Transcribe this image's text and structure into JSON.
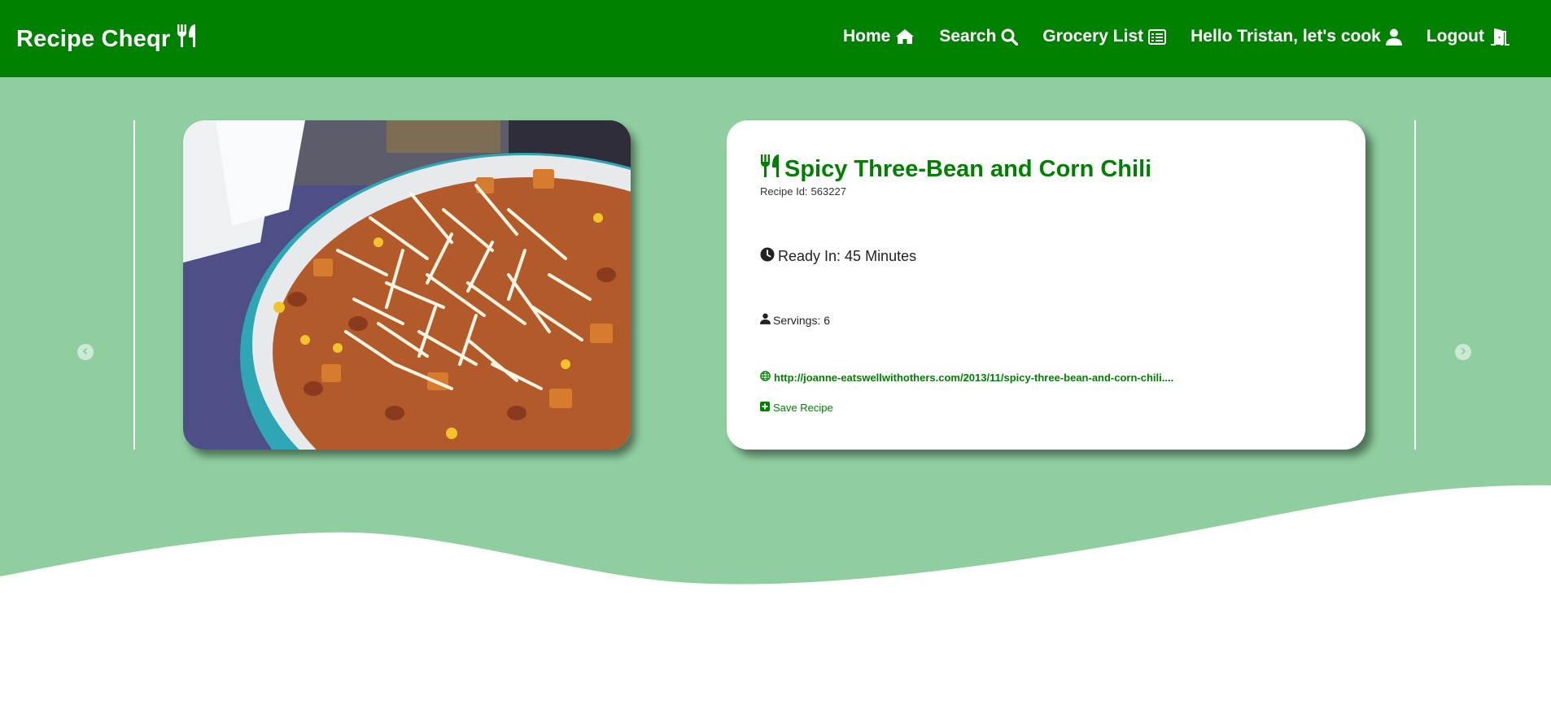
{
  "app": {
    "brand": "Recipe Cheqr",
    "brand_icon": "fork-knife-icon"
  },
  "nav": {
    "items": [
      {
        "label": "Home",
        "icon": "home-icon"
      },
      {
        "label": "Search",
        "icon": "search-icon"
      },
      {
        "label": "Grocery List",
        "icon": "list-icon"
      },
      {
        "label": "Hello Tristan, let's cook",
        "icon": "user-icon"
      },
      {
        "label": "Logout",
        "icon": "door-icon"
      }
    ]
  },
  "recipe": {
    "title": "Spicy Three-Bean and Corn Chili",
    "id_label": "Recipe Id:",
    "id_value": "563227",
    "ready_in": "Ready In: 45 Minutes",
    "servings": "Servings: 6",
    "source_url": "http://joanne-eatswellwithothers.com/2013/11/spicy-three-bean-and-corn-chili....",
    "save_label": "Save Recipe"
  },
  "colors": {
    "nav_green": "#008000",
    "hero_green": "#8fce9f",
    "text_green": "#008000"
  }
}
